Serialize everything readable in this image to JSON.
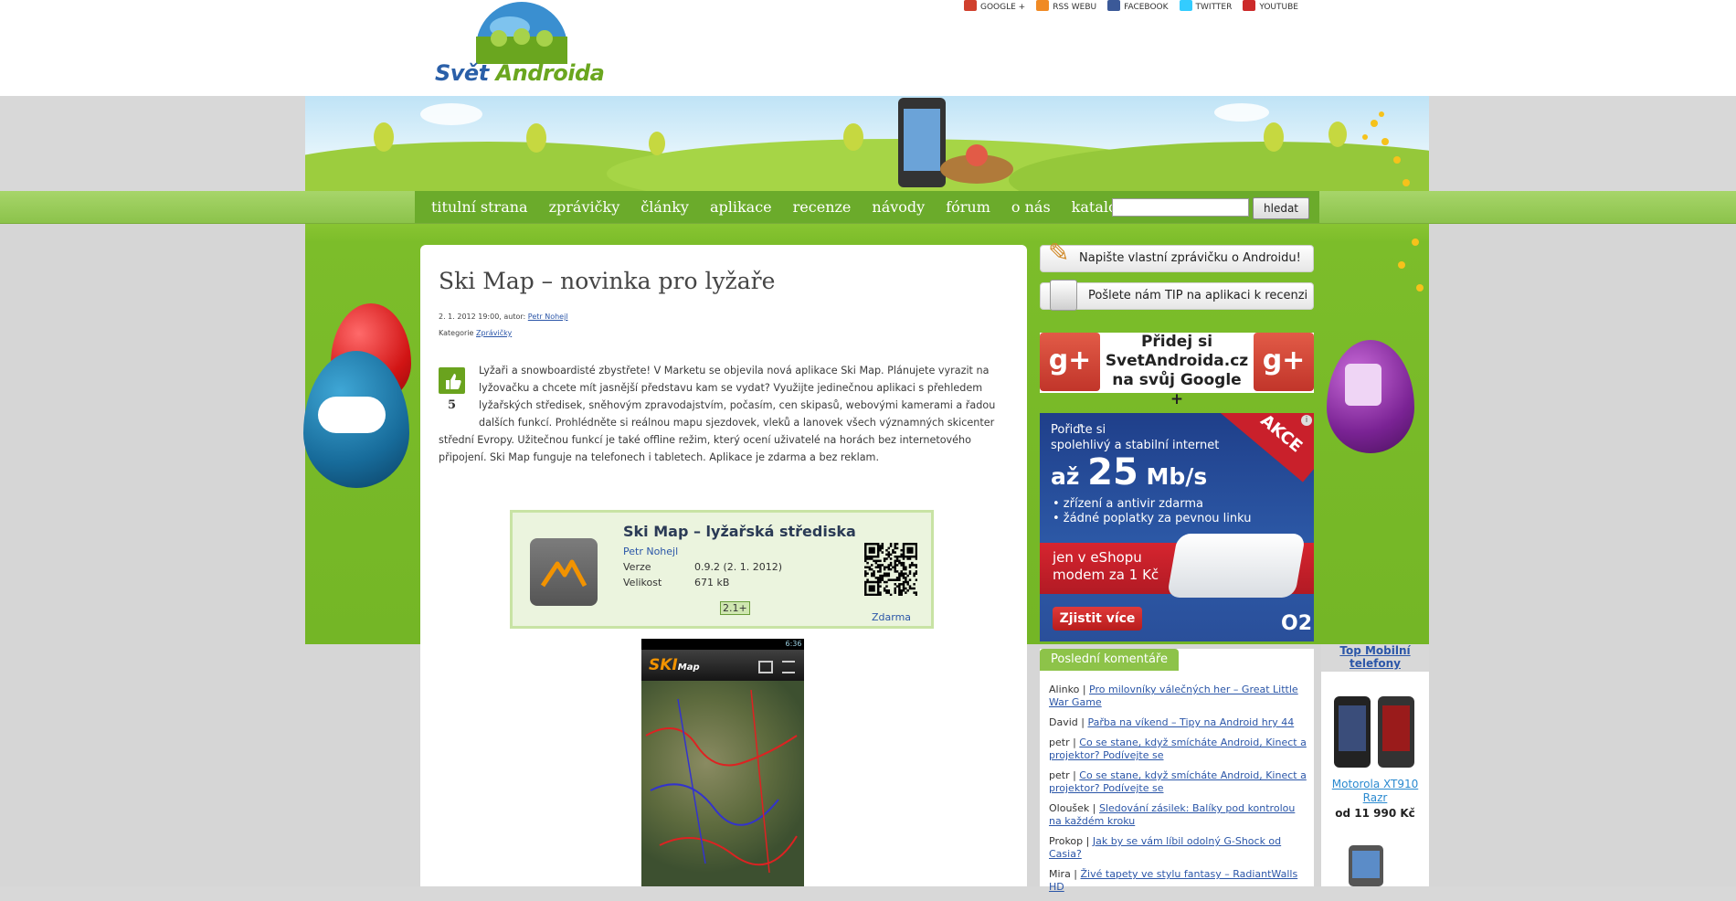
{
  "site": {
    "logo_text_1": "Svět",
    "logo_text_2": "Androida"
  },
  "social": [
    {
      "label": "GOOGLE +",
      "icon": "google-plus-icon",
      "color": "#d0402d"
    },
    {
      "label": "RSS WEBU",
      "icon": "rss-icon",
      "color": "#f08a24"
    },
    {
      "label": "FACEBOOK",
      "icon": "facebook-icon",
      "color": "#3b5998"
    },
    {
      "label": "TWITTER",
      "icon": "twitter-icon",
      "color": "#33ccff"
    },
    {
      "label": "YOUTUBE",
      "icon": "youtube-icon",
      "color": "#cc2a2a"
    }
  ],
  "nav": {
    "items": [
      "titulní strana",
      "zprávičky",
      "články",
      "aplikace",
      "recenze",
      "návody",
      "fórum",
      "o nás",
      "katalog"
    ],
    "search_value": "",
    "search_button": "hledat"
  },
  "article": {
    "title": "Ski Map – novinka pro lyžaře",
    "meta_prefix": "2. 1. 2012 19:00, autor: ",
    "author": "Petr Nohejl",
    "category_prefix": "Kategorie ",
    "category": "Zprávičky",
    "likes": "5",
    "body": "Lyžaři a snowboardisté zbystřete! V Marketu se objevila nová aplikace Ski Map. Plánujete vyrazit na lyžovačku a chcete mít jasnější představu kam se vydat? Využijte jedinečnou aplikaci s přehledem lyžařských středisek, sněhovým zpravodajstvím, počasím, cen skipasů, webovými kamerami a řadou dalších funkcí. Prohlédněte si reálnou mapu sjezdovek, vleků a lanovek všech významných skicenter střední Evropy. Užitečnou funkcí je také offline režim, který ocení uživatelé na horách bez internetového připojení. Ski Map funguje na telefonech i tabletech. Aplikace je zdarma a bez reklam."
  },
  "app": {
    "name": "Ski Map – lyžařská střediska",
    "author": "Petr Nohejl",
    "version_label": "Verze",
    "version_value": "0.9.2 (2. 1. 2012)",
    "size_label": "Velikost",
    "size_value": "671 kB",
    "android": "2.1+",
    "price": "Zdarma"
  },
  "screenshot": {
    "time": "6:36",
    "logo_ski": "SKI",
    "logo_map": "Map"
  },
  "sidebar": {
    "write_news": "Napište vlastní zprávičku o Androidu!",
    "send_tip": "Pošlete nám TIP na aplikaci k recenzi",
    "gplus_text": "Přidej si SvetAndroida.cz na svůj Google +",
    "gplus_icon_label": "g+"
  },
  "ad": {
    "line1": "Pořiďte si",
    "line2": "spolehlivý a stabilní internet",
    "speed_prefix": "až",
    "speed_number": "25",
    "speed_unit": "Mb/s",
    "bullet1": "• zřízení a antivir zdarma",
    "bullet2": "• žádné poplatky za pevnou linku",
    "red_line1": "jen v eShopu",
    "red_line2": "modem za 1 Kč",
    "cta": "Zjistit více",
    "badge": "AKCE",
    "brand": "O2",
    "info": "i"
  },
  "comments": {
    "tab": "Poslední komentáře",
    "items": [
      {
        "user": "Alinko",
        "link": "Pro milovníky válečných her – Great Little War Game"
      },
      {
        "user": "David",
        "link": "Pařba na víkend – Tipy na Android hry 44"
      },
      {
        "user": "petr",
        "link": "Co se stane, když smícháte Android, Kinect a projektor? Podívejte se"
      },
      {
        "user": "petr",
        "link": "Co se stane, když smícháte Android, Kinect a projektor? Podívejte se"
      },
      {
        "user": "Oloušek",
        "link": "Sledování zásilek: Balíky pod kontrolou na každém kroku"
      },
      {
        "user": "Prokop",
        "link": "Jak by se vám líbil odolný G-Shock od Casia?"
      },
      {
        "user": "Mira",
        "link": "Živé tapety ve stylu fantasy – RadiantWalls HD"
      }
    ]
  },
  "top_phones": {
    "title": "Top Mobilní telefony",
    "phone_name": "Motorola XT910 Razr",
    "phone_price": "od 11 990 Kč"
  },
  "colors": {
    "nav_green": "#6bab2b",
    "link_blue": "#2b56a8",
    "ad_blue": "#2d5aa8",
    "ad_red": "#d6252f"
  }
}
